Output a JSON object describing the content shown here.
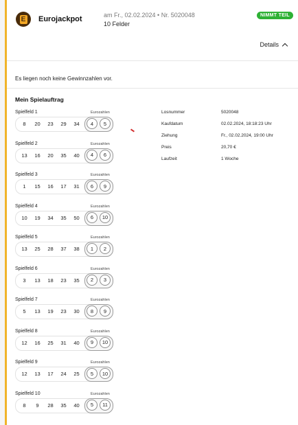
{
  "header": {
    "product_name": "Eurojackpot",
    "draw_info": "am Fr., 02.02.2024 • Nr. 5020048",
    "fields_count": "10 Felder",
    "status_badge": "NIMMT TEIL",
    "details_label": "Details"
  },
  "no_results_text": "Es liegen noch keine Gewinnzahlen vor.",
  "order_title": "Mein Spielauftrag",
  "euro_label": "Eurozahlen",
  "fields": [
    {
      "label": "Spielfeld 1",
      "numbers": [
        "8",
        "20",
        "23",
        "29",
        "34"
      ],
      "euro": [
        "4",
        "5"
      ]
    },
    {
      "label": "Spielfeld 2",
      "numbers": [
        "13",
        "16",
        "20",
        "35",
        "40"
      ],
      "euro": [
        "4",
        "6"
      ]
    },
    {
      "label": "Spielfeld 3",
      "numbers": [
        "1",
        "15",
        "16",
        "17",
        "31"
      ],
      "euro": [
        "6",
        "9"
      ]
    },
    {
      "label": "Spielfeld 4",
      "numbers": [
        "10",
        "19",
        "34",
        "35",
        "50"
      ],
      "euro": [
        "6",
        "10"
      ]
    },
    {
      "label": "Spielfeld 5",
      "numbers": [
        "13",
        "25",
        "28",
        "37",
        "38"
      ],
      "euro": [
        "1",
        "2"
      ]
    },
    {
      "label": "Spielfeld 6",
      "numbers": [
        "3",
        "13",
        "18",
        "23",
        "35"
      ],
      "euro": [
        "2",
        "3"
      ]
    },
    {
      "label": "Spielfeld 7",
      "numbers": [
        "5",
        "13",
        "19",
        "23",
        "30"
      ],
      "euro": [
        "8",
        "9"
      ]
    },
    {
      "label": "Spielfeld 8",
      "numbers": [
        "12",
        "16",
        "25",
        "31",
        "40"
      ],
      "euro": [
        "9",
        "10"
      ]
    },
    {
      "label": "Spielfeld 9",
      "numbers": [
        "12",
        "13",
        "17",
        "24",
        "25"
      ],
      "euro": [
        "5",
        "10"
      ]
    },
    {
      "label": "Spielfeld 10",
      "numbers": [
        "8",
        "9",
        "28",
        "35",
        "40"
      ],
      "euro": [
        "5",
        "11"
      ]
    }
  ],
  "info": [
    {
      "key": "Losnummer",
      "value": "5020048"
    },
    {
      "key": "Kaufdatum",
      "value": "02.02.2024, 18:18:23 Uhr"
    },
    {
      "key": "Ziehung",
      "value": "Fr., 02.02.2024, 19:00 Uhr"
    },
    {
      "key": "Preis",
      "value": "20,70 €"
    },
    {
      "key": "Laufzeit",
      "value": "1 Woche"
    }
  ],
  "colors": {
    "accent_bar": "#f0b429",
    "badge": "#2eb135",
    "logo_bg": "#4a2c0a"
  }
}
